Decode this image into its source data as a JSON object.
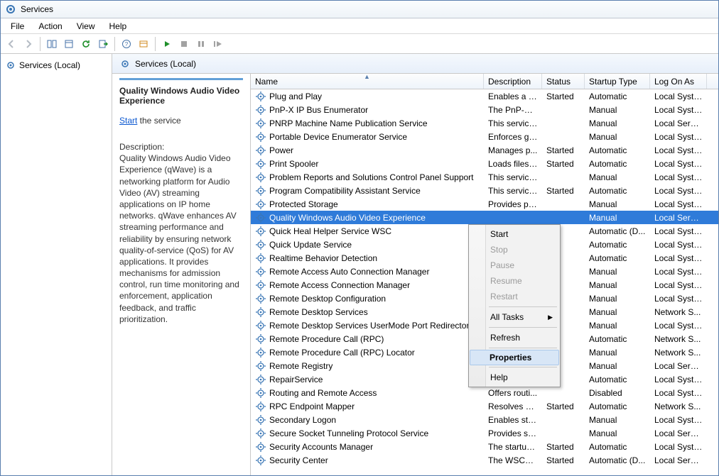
{
  "window": {
    "title": "Services"
  },
  "menu": {
    "file": "File",
    "action": "Action",
    "view": "View",
    "help": "Help"
  },
  "tree": {
    "root": "Services (Local)"
  },
  "header": {
    "title": "Services (Local)"
  },
  "detail": {
    "name": "Quality Windows Audio Video Experience",
    "start_link": "Start",
    "start_suffix": " the service",
    "desc_heading": "Description:",
    "description": "Quality Windows Audio Video Experience (qWave) is a networking platform for Audio Video (AV) streaming applications on IP home networks. qWave enhances AV streaming performance and reliability by ensuring network quality-of-service (QoS) for AV applications. It provides mechanisms for admission control, run time monitoring and enforcement, application feedback, and traffic prioritization."
  },
  "columns": {
    "name": "Name",
    "desc": "Description",
    "status": "Status",
    "startup": "Startup Type",
    "logon": "Log On As"
  },
  "rows": [
    {
      "name": "Plug and Play",
      "desc": "Enables a c...",
      "status": "Started",
      "startup": "Automatic",
      "logon": "Local Syste..."
    },
    {
      "name": "PnP-X IP Bus Enumerator",
      "desc": "The PnP-X ...",
      "status": "",
      "startup": "Manual",
      "logon": "Local Syste..."
    },
    {
      "name": "PNRP Machine Name Publication Service",
      "desc": "This service ...",
      "status": "",
      "startup": "Manual",
      "logon": "Local Service"
    },
    {
      "name": "Portable Device Enumerator Service",
      "desc": "Enforces gr...",
      "status": "",
      "startup": "Manual",
      "logon": "Local Syste..."
    },
    {
      "name": "Power",
      "desc": "Manages p...",
      "status": "Started",
      "startup": "Automatic",
      "logon": "Local Syste..."
    },
    {
      "name": "Print Spooler",
      "desc": "Loads files t...",
      "status": "Started",
      "startup": "Automatic",
      "logon": "Local Syste..."
    },
    {
      "name": "Problem Reports and Solutions Control Panel Support",
      "desc": "This service ...",
      "status": "",
      "startup": "Manual",
      "logon": "Local Syste..."
    },
    {
      "name": "Program Compatibility Assistant Service",
      "desc": "This service ...",
      "status": "Started",
      "startup": "Automatic",
      "logon": "Local Syste..."
    },
    {
      "name": "Protected Storage",
      "desc": "Provides pr...",
      "status": "",
      "startup": "Manual",
      "logon": "Local Syste..."
    },
    {
      "name": "Quality Windows Audio Video Experience",
      "desc": "",
      "status": "",
      "startup": "Manual",
      "logon": "Local Service",
      "selected": true
    },
    {
      "name": "Quick Heal Helper Service WSC",
      "desc": "",
      "status": "ed",
      "startup": "Automatic (D...",
      "logon": "Local Syste..."
    },
    {
      "name": "Quick Update Service",
      "desc": "",
      "status": "ed",
      "startup": "Automatic",
      "logon": "Local Syste..."
    },
    {
      "name": "Realtime Behavior Detection",
      "desc": "",
      "status": "ed",
      "startup": "Automatic",
      "logon": "Local Syste..."
    },
    {
      "name": "Remote Access Auto Connection Manager",
      "desc": "",
      "status": "",
      "startup": "Manual",
      "logon": "Local Syste..."
    },
    {
      "name": "Remote Access Connection Manager",
      "desc": "",
      "status": "",
      "startup": "Manual",
      "logon": "Local Syste..."
    },
    {
      "name": "Remote Desktop Configuration",
      "desc": "",
      "status": "",
      "startup": "Manual",
      "logon": "Local Syste..."
    },
    {
      "name": "Remote Desktop Services",
      "desc": "",
      "status": "",
      "startup": "Manual",
      "logon": "Network S..."
    },
    {
      "name": "Remote Desktop Services UserMode Port Redirector",
      "desc": "",
      "status": "",
      "startup": "Manual",
      "logon": "Local Syste..."
    },
    {
      "name": "Remote Procedure Call (RPC)",
      "desc": "",
      "status": "ed",
      "startup": "Automatic",
      "logon": "Network S..."
    },
    {
      "name": "Remote Procedure Call (RPC) Locator",
      "desc": "",
      "status": "",
      "startup": "Manual",
      "logon": "Network S..."
    },
    {
      "name": "Remote Registry",
      "desc": "",
      "status": "",
      "startup": "Manual",
      "logon": "Local Service"
    },
    {
      "name": "RepairService",
      "desc": "",
      "status": "ed",
      "startup": "Automatic",
      "logon": "Local Syste..."
    },
    {
      "name": "Routing and Remote Access",
      "desc": "Offers routi...",
      "status": "",
      "startup": "Disabled",
      "logon": "Local Syste..."
    },
    {
      "name": "RPC Endpoint Mapper",
      "desc": "Resolves RP...",
      "status": "Started",
      "startup": "Automatic",
      "logon": "Network S..."
    },
    {
      "name": "Secondary Logon",
      "desc": "Enables star...",
      "status": "",
      "startup": "Manual",
      "logon": "Local Syste..."
    },
    {
      "name": "Secure Socket Tunneling Protocol Service",
      "desc": "Provides su...",
      "status": "",
      "startup": "Manual",
      "logon": "Local Service"
    },
    {
      "name": "Security Accounts Manager",
      "desc": "The startup ...",
      "status": "Started",
      "startup": "Automatic",
      "logon": "Local Syste..."
    },
    {
      "name": "Security Center",
      "desc": "The WSCSV...",
      "status": "Started",
      "startup": "Automatic (D...",
      "logon": "Local Service"
    }
  ],
  "context": {
    "start": "Start",
    "stop": "Stop",
    "pause": "Pause",
    "resume": "Resume",
    "restart": "Restart",
    "alltasks": "All Tasks",
    "refresh": "Refresh",
    "properties": "Properties",
    "help": "Help"
  }
}
